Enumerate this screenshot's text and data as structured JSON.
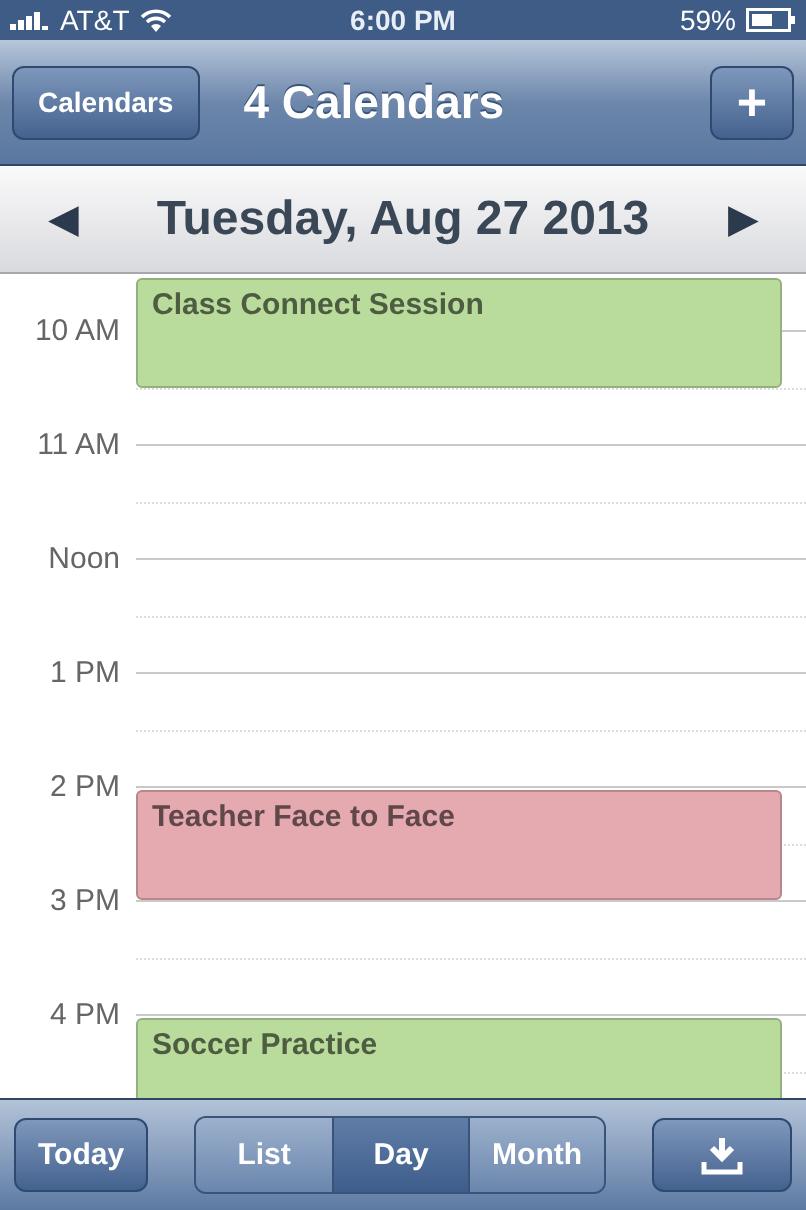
{
  "status_bar": {
    "carrier": "AT&T",
    "time": "6:00 PM",
    "battery": "59%"
  },
  "nav_bar": {
    "left_button": "Calendars",
    "title": "4 Calendars",
    "right_button": "+"
  },
  "date_bar": {
    "prev": "◀",
    "date": "Tuesday, Aug 27 2013",
    "next": "▶"
  },
  "hours": [
    {
      "label": "10 AM",
      "event": {
        "title": "Class Connect Session",
        "color": "#b9dc9c",
        "kind": "half_before"
      }
    },
    {
      "label": "11 AM"
    },
    {
      "label": "Noon"
    },
    {
      "label": "1 PM"
    },
    {
      "label": "2 PM",
      "event": {
        "title": "Teacher Face to Face",
        "color": "#e5a9b0",
        "kind": "on_hour"
      }
    },
    {
      "label": "3 PM"
    },
    {
      "label": "4 PM",
      "event": {
        "title": "Soccer Practice",
        "color": "#b9dc9c",
        "kind": "on_hour"
      }
    }
  ],
  "toolbar": {
    "today": "Today",
    "views": [
      {
        "label": "List",
        "selected": false
      },
      {
        "label": "Day",
        "selected": true
      },
      {
        "label": "Month",
        "selected": false
      }
    ]
  }
}
